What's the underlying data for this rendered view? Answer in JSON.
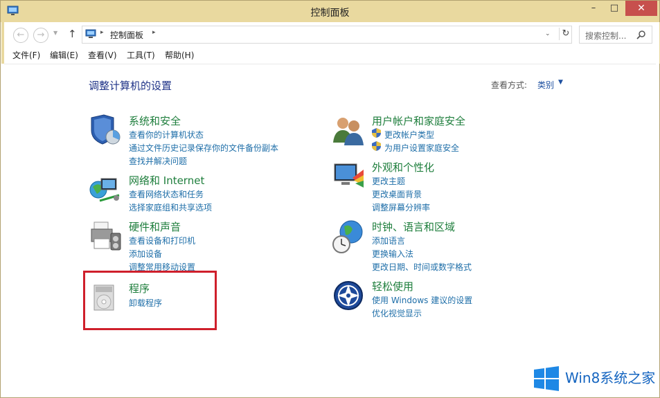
{
  "window": {
    "title": "控制面板",
    "min": "–",
    "max": "□",
    "close": "✕"
  },
  "nav": {
    "back": "←",
    "forward": "→",
    "up": "↑",
    "refresh": "↻"
  },
  "address": {
    "crumb": "控制面板",
    "sep": "▸",
    "dropdown": "⌄"
  },
  "search": {
    "placeholder": "搜索控制..."
  },
  "menu": [
    "文件(F)",
    "编辑(E)",
    "查看(V)",
    "工具(T)",
    "帮助(H)"
  ],
  "page": {
    "title": "调整计算机的设置",
    "view_by_label": "查看方式:",
    "view_by_value": "类别",
    "caret": "▼"
  },
  "categories": [
    {
      "title": "系统和安全",
      "links": [
        "查看你的计算机状态",
        "通过文件历史记录保存你的文件备份副本",
        "查找并解决问题"
      ]
    },
    {
      "title": "网络和 Internet",
      "links": [
        "查看网络状态和任务",
        "选择家庭组和共享选项"
      ]
    },
    {
      "title": "硬件和声音",
      "links": [
        "查看设备和打印机",
        "添加设备",
        "调整常用移动设置"
      ]
    },
    {
      "title": "程序",
      "links": [
        "卸载程序"
      ]
    },
    {
      "title": "用户帐户和家庭安全",
      "links": [
        "更改帐户类型",
        "为用户设置家庭安全"
      ]
    },
    {
      "title": "外观和个性化",
      "links": [
        "更改主题",
        "更改桌面背景",
        "调整屏幕分辨率"
      ]
    },
    {
      "title": "时钟、语言和区域",
      "links": [
        "添加语言",
        "更换输入法",
        "更改日期、时间或数字格式"
      ]
    },
    {
      "title": "轻松使用",
      "links": [
        "使用 Windows 建议的设置",
        "优化视觉显示"
      ]
    }
  ],
  "watermark": {
    "text": "Win8系统之家"
  },
  "colors": {
    "titlebar": "#e9d99f",
    "link": "#1e6ea8",
    "heading": "#1e7e3c",
    "highlight": "#cf1f2b",
    "close": "#c7504d"
  }
}
